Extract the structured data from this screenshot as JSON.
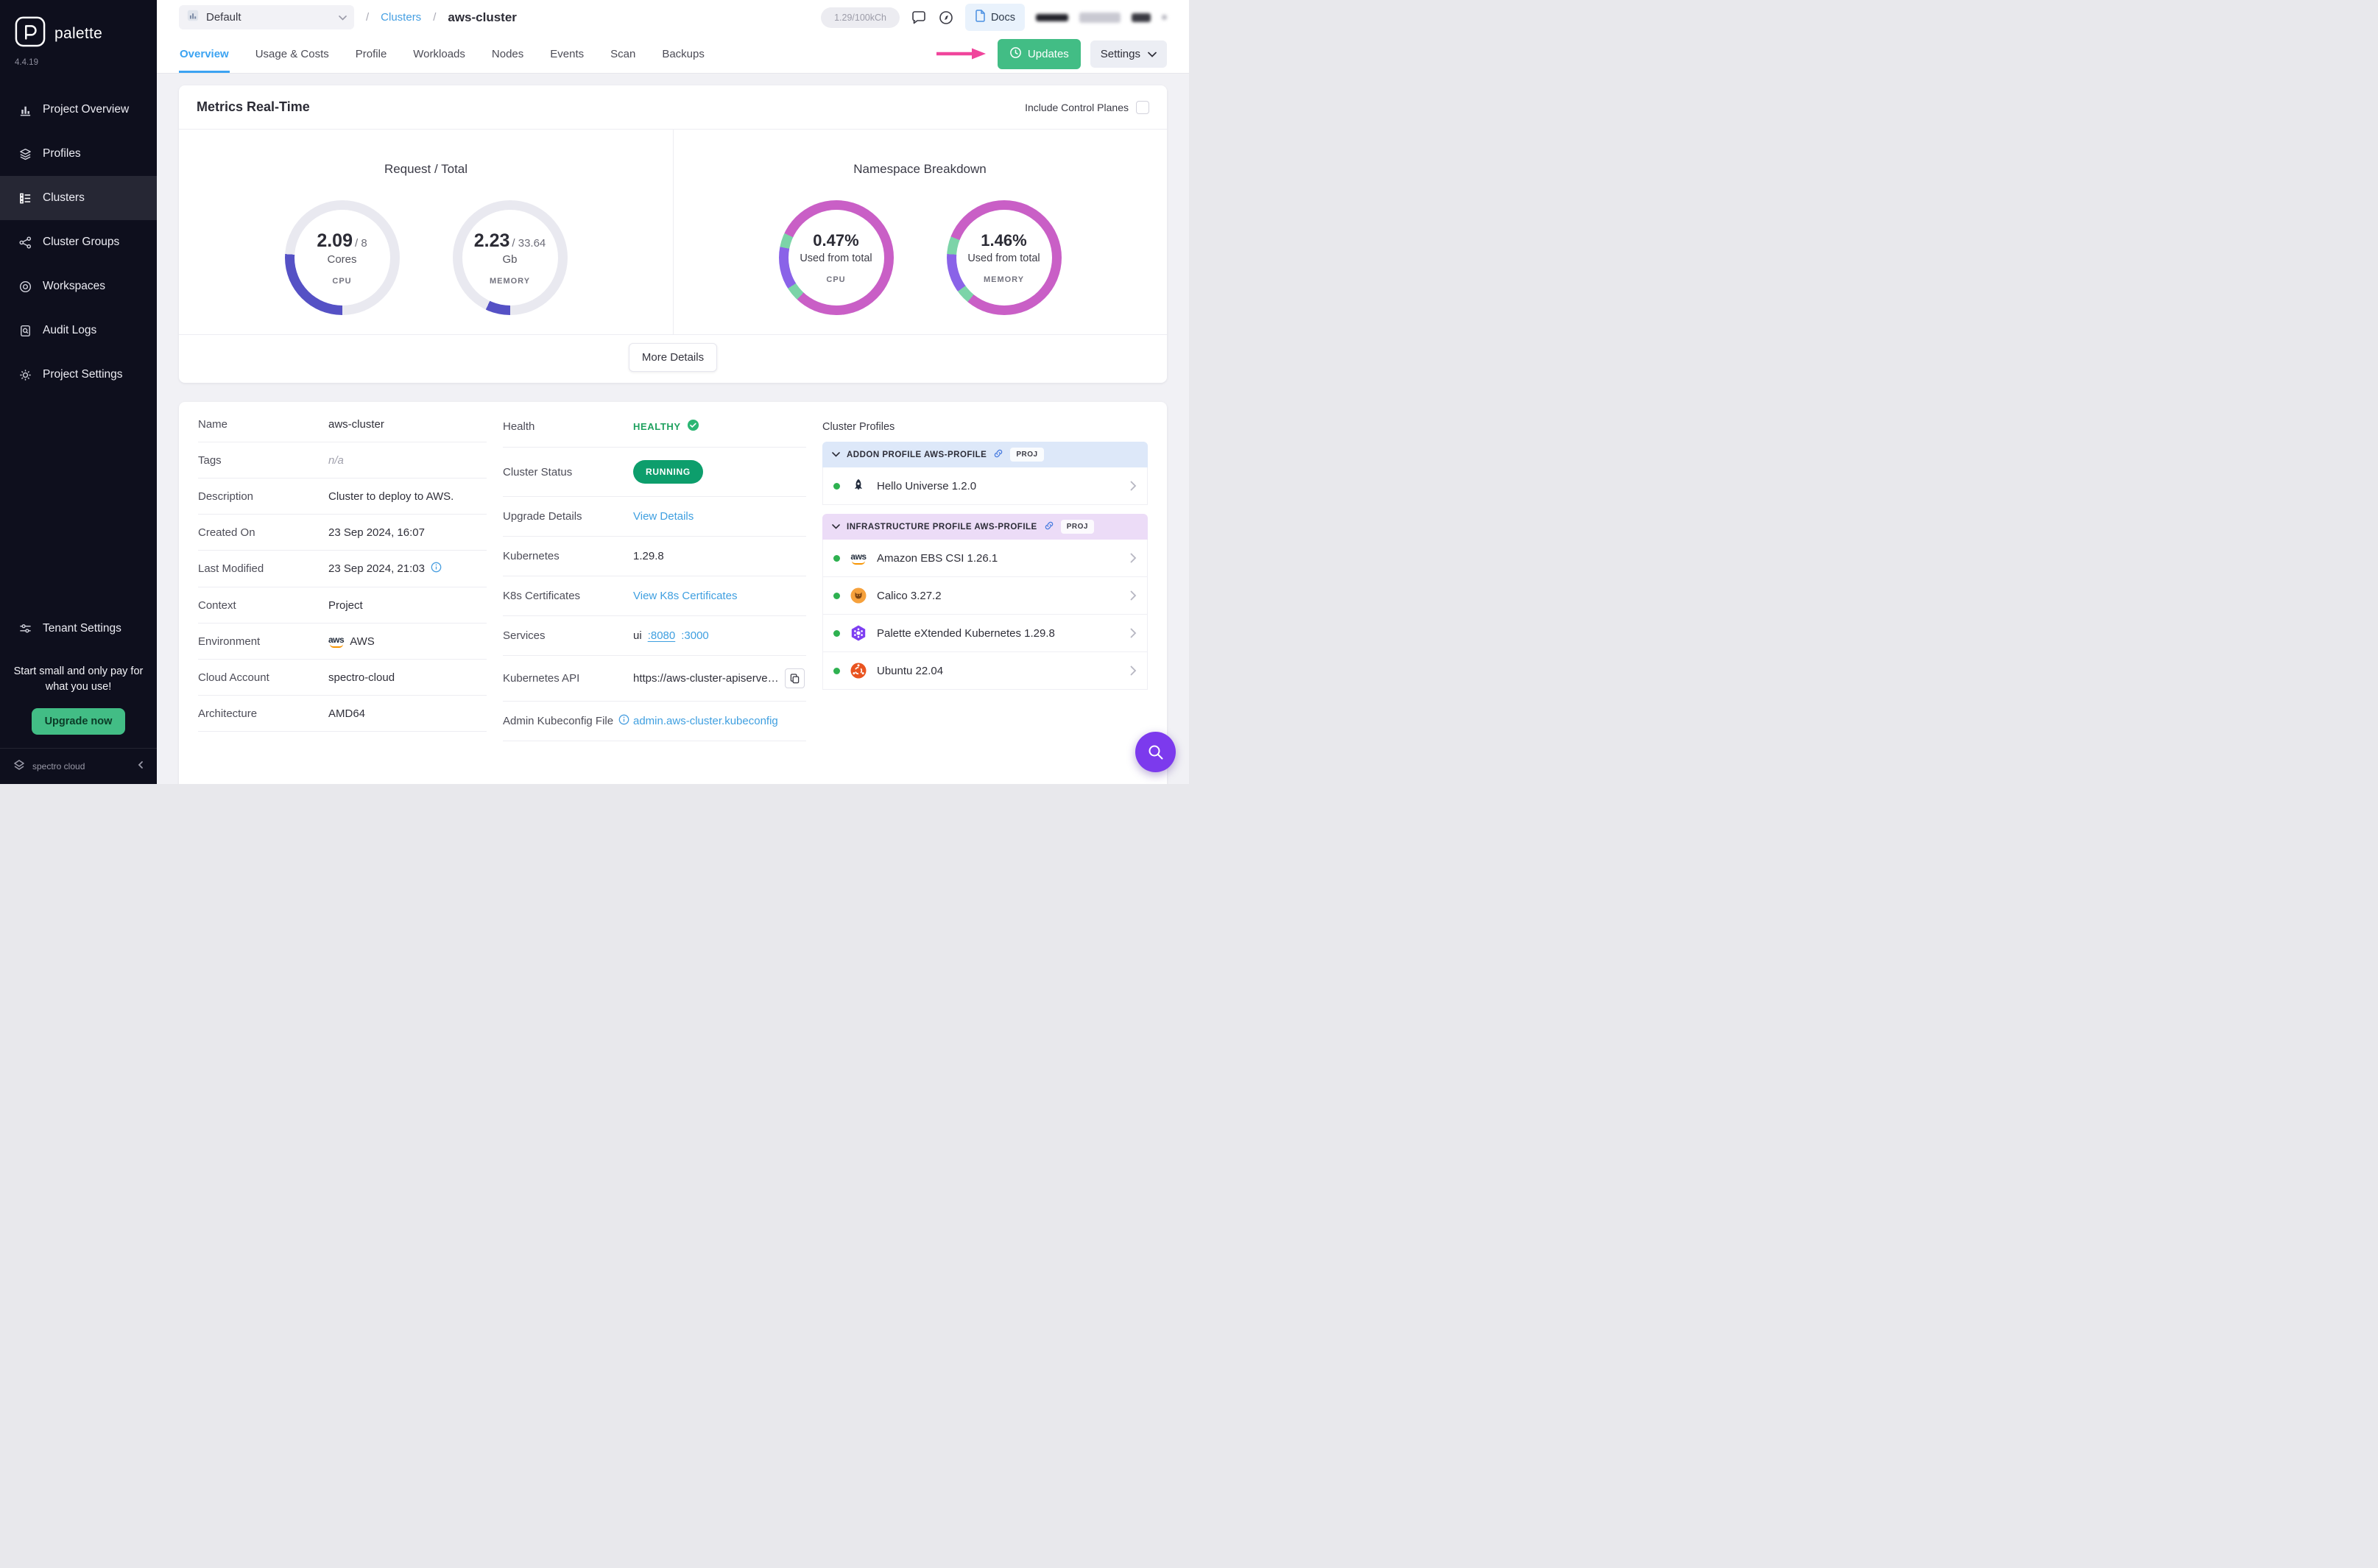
{
  "icons": {
    "slash": "/"
  },
  "sidebar": {
    "brand": "palette",
    "version": "4.4.19",
    "items": [
      {
        "label": "Project Overview"
      },
      {
        "label": "Profiles"
      },
      {
        "label": "Clusters"
      },
      {
        "label": "Cluster Groups"
      },
      {
        "label": "Workspaces"
      },
      {
        "label": "Audit Logs"
      },
      {
        "label": "Project Settings"
      }
    ],
    "tenant_settings_label": "Tenant Settings",
    "promo_text": "Start small and only pay for what you use!",
    "upgrade_button_label": "Upgrade now",
    "footer_brand": "spectro cloud"
  },
  "header": {
    "project_selector_label": "Default",
    "breadcrumb_root": "Clusters",
    "breadcrumb_current": "aws-cluster",
    "usage_pill": "1.29/100kCh",
    "docs_label": "Docs",
    "updates_label": "Updates",
    "settings_label": "Settings",
    "tabs": [
      {
        "label": "Overview"
      },
      {
        "label": "Usage & Costs"
      },
      {
        "label": "Profile"
      },
      {
        "label": "Workloads"
      },
      {
        "label": "Nodes"
      },
      {
        "label": "Events"
      },
      {
        "label": "Scan"
      },
      {
        "label": "Backups"
      }
    ]
  },
  "metrics": {
    "title": "Metrics Real-Time",
    "include_control_planes_label": "Include Control Planes",
    "request_total_title": "Request / Total",
    "namespace_title": "Namespace Breakdown",
    "more_details_label": "More Details",
    "gauges": [
      {
        "value": "2.09",
        "total": "/ 8",
        "unit": "Cores",
        "label": "CPU",
        "percent": 26,
        "color": "#5551c5"
      },
      {
        "value": "2.23",
        "total": "/ 33.64",
        "unit": "Gb",
        "label": "MEMORY",
        "percent": 7,
        "color": "#5551c5"
      }
    ],
    "donuts": [
      {
        "value": "0.47%",
        "caption": "Used from total",
        "label": "CPU",
        "stops": "#c95fc6 0% 62%, #7cd4a8 62% 66%, #8a63e8 66% 78%, #7cd4a8 78% 82%, #c95fc6 82% 100%"
      },
      {
        "value": "1.46%",
        "caption": "Used from total",
        "label": "MEMORY",
        "stops": "#c95fc6 0% 61%, #7cd4a8 61% 65%, #8a63e8 65% 76%, #7cd4a8 76% 81%, #c95fc6 81% 100%"
      }
    ]
  },
  "details": {
    "left_rows": [
      {
        "label": "Name",
        "value": "aws-cluster"
      },
      {
        "label": "Tags",
        "value": "n/a"
      },
      {
        "label": "Description",
        "value": "Cluster to deploy to AWS."
      },
      {
        "label": "Created On",
        "value": "23 Sep 2024, 16:07"
      },
      {
        "label": "Last Modified",
        "value": "23 Sep 2024, 21:03"
      },
      {
        "label": "Context",
        "value": "Project"
      },
      {
        "label": "Environment",
        "value": "AWS"
      },
      {
        "label": "Cloud Account",
        "value": "spectro-cloud"
      },
      {
        "label": "Architecture",
        "value": "AMD64"
      }
    ],
    "health_label": "Health",
    "health_value": "HEALTHY",
    "cluster_status_label": "Cluster Status",
    "cluster_status_value": "RUNNING",
    "upgrade_label": "Upgrade Details",
    "upgrade_link": "View Details",
    "kubernetes_label": "Kubernetes",
    "kubernetes_value": "1.29.8",
    "certs_label": "K8s Certificates",
    "certs_link": "View K8s Certificates",
    "services_label": "Services",
    "services_value": "ui",
    "services_port1": ":8080",
    "services_port2": ":3000",
    "api_label": "Kubernetes API",
    "api_value": "https://aws-cluster-apiserve…",
    "kubeconfig_label": "Admin Kubeconfig File",
    "kubeconfig_link": "admin.aws-cluster.kubeconfig"
  },
  "profiles": {
    "title": "Cluster Profiles",
    "groups": [
      {
        "header": "ADDON PROFILE AWS-PROFILE",
        "badge": "PROJ",
        "items": [
          {
            "name": "Hello Universe 1.2.0"
          }
        ]
      },
      {
        "header": "INFRASTRUCTURE PROFILE AWS-PROFILE",
        "badge": "PROJ",
        "items": [
          {
            "name": "Amazon EBS CSI 1.26.1"
          },
          {
            "name": "Calico 3.27.2"
          },
          {
            "name": "Palette eXtended Kubernetes 1.29.8"
          },
          {
            "name": "Ubuntu 22.04"
          }
        ]
      }
    ]
  },
  "colors": {
    "accent_green": "#42bd85",
    "running_green": "#0d9e6c",
    "link_blue": "#3f9fe0",
    "active_tab_blue": "#3ba3f2",
    "donut_pink": "#c95fc6",
    "donut_purple": "#8a63e8",
    "donut_green": "#7cd4a8",
    "gauge_purple": "#5551c5",
    "annotation_pink": "#f0459c"
  }
}
